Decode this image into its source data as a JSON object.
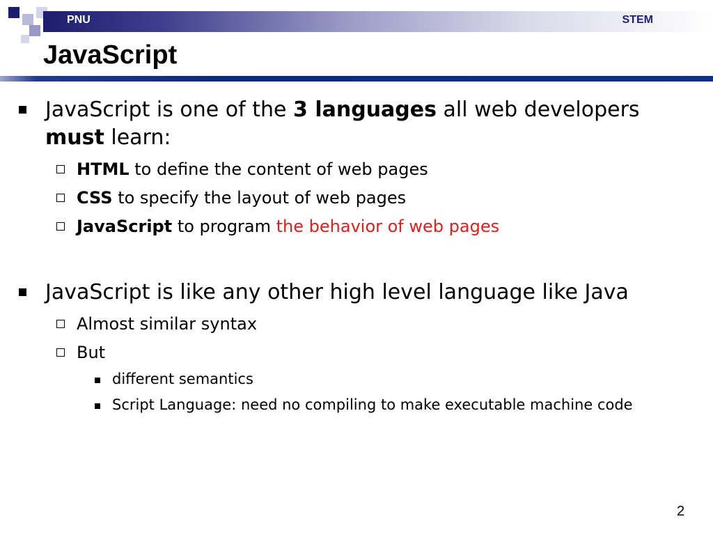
{
  "header": {
    "left_label": "PNU",
    "right_label": "STEM",
    "bar_color": "#1d1d6e",
    "accent_color": "#0a2a80"
  },
  "slide": {
    "title": "JavaScript",
    "page_number": "2"
  },
  "bullets": {
    "b1": {
      "t1": "JavaScript is one of the ",
      "t2": "3 languages",
      "t3": " all web developers ",
      "t4": "must",
      "t5": " learn:"
    },
    "b1_sub": [
      {
        "bold": "HTML",
        "text": " to define the content of web pages"
      },
      {
        "bold": "CSS",
        "text": " to specify the layout of web pages"
      },
      {
        "bold": "JavaScript",
        "text": " to program ",
        "red": "the behavior of web pages"
      }
    ],
    "b2": {
      "text": "JavaScript is like any other high level language like Java"
    },
    "b2_sub": [
      {
        "text": "Almost similar syntax"
      },
      {
        "text": "But"
      }
    ],
    "b2_sub2": [
      {
        "text": "different semantics"
      },
      {
        "text": "Script Language: need no compiling to make executable machine code"
      }
    ]
  }
}
